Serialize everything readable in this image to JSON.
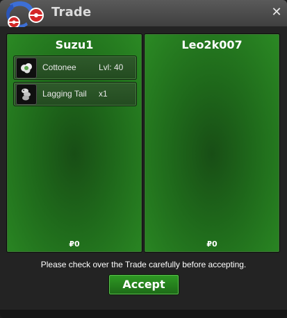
{
  "window": {
    "title": "Trade",
    "close_icon": "close-icon",
    "logo_icon": "trade-logo-icon"
  },
  "panels": [
    {
      "player_name": "Suzu1",
      "items": [
        {
          "name": "Cottonee",
          "extra": "Lvl: 40",
          "icon": "cottonee-icon"
        },
        {
          "name": "Lagging Tail",
          "extra": "x1",
          "icon": "lagging-tail-icon"
        }
      ],
      "money": "₽0"
    },
    {
      "player_name": "Leo2k007",
      "items": [],
      "money": "₽0"
    }
  ],
  "notice": "Please check over the Trade carefully before accepting.",
  "accept_label": "Accept",
  "colors": {
    "panel_green": "#1f6a1b",
    "accept_green": "#2f9a24",
    "titlebar": "#4a4a4a"
  }
}
